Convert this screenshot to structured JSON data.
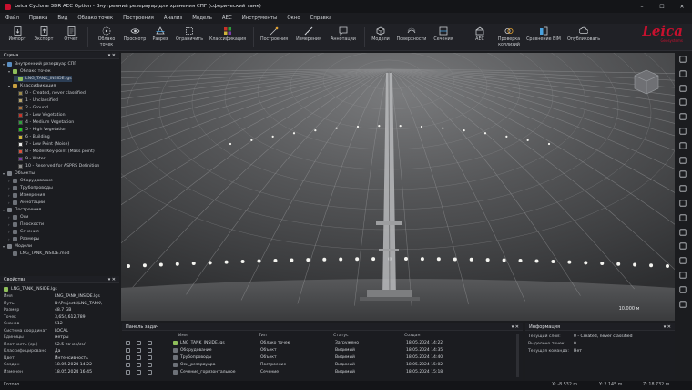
{
  "window": {
    "title": "Leica Cyclone 3DR AEC Option - Внутренний резервуар для хранения СПГ (сферический танк)",
    "minimize": "–",
    "maximize": "☐",
    "close": "✕"
  },
  "menu": [
    "Файл",
    "Правка",
    "Вид",
    "Облако точек",
    "Построения",
    "Анализ",
    "Модель",
    "AEC",
    "Инструменты",
    "Окно",
    "Справка"
  ],
  "ribbon": [
    {
      "label": "Импорт",
      "icon": "import-icon"
    },
    {
      "label": "Экспорт",
      "icon": "export-icon"
    },
    {
      "label": "Отчет",
      "icon": "report-icon"
    },
    {
      "label": "Облако\nточек",
      "icon": "point-cloud-icon"
    },
    {
      "label": "Просмотр",
      "icon": "view-icon"
    },
    {
      "label": "Разрез",
      "icon": "section-icon"
    },
    {
      "label": "Ограничить",
      "icon": "clip-icon"
    },
    {
      "label": "Классификация",
      "icon": "classification-icon"
    },
    {
      "label": "Построения",
      "icon": "constructions-icon"
    },
    {
      "label": "Измерения",
      "icon": "measure-icon"
    },
    {
      "label": "Аннотации",
      "icon": "annotation-icon"
    },
    {
      "label": "Модели",
      "icon": "models-icon"
    },
    {
      "label": "Поверхности",
      "icon": "surfaces-icon"
    },
    {
      "label": "Сечения",
      "icon": "cross-section-icon"
    },
    {
      "label": "AEC",
      "icon": "aec-icon"
    },
    {
      "label": "Проверка\nколлизий",
      "icon": "clash-icon"
    },
    {
      "label": "Сравнение BIM",
      "icon": "bim-compare-icon"
    },
    {
      "label": "Опубликовать",
      "icon": "publish-icon"
    }
  ],
  "logo": {
    "word": "Leica",
    "sub": "Geosystems",
    "color": "#c8102e"
  },
  "scene": {
    "header": "Сцена",
    "root": "Внутренний резервуар СПГ",
    "cloud_group": "Облако точек",
    "cloud_item": "LNG_TANK_INSIDE.lgs",
    "class_group": "Классификация",
    "classes": [
      {
        "label": "0 - Created, never classified",
        "color": "#9c8a4a"
      },
      {
        "label": "1 - Unclassified",
        "color": "#b5a36a"
      },
      {
        "label": "2 - Ground",
        "color": "#a8703a"
      },
      {
        "label": "3 - Low Vegetation",
        "color": "#c83228"
      },
      {
        "label": "4 - Medium Vegetation",
        "color": "#2e9e3e"
      },
      {
        "label": "5 - High Vegetation",
        "color": "#1ec81e"
      },
      {
        "label": "6 - Building",
        "color": "#d0b43a"
      },
      {
        "label": "7 - Low Point (Noise)",
        "color": "#e8e8e8"
      },
      {
        "label": "8 - Model Key-point (Mass point)",
        "color": "#d8503c"
      },
      {
        "label": "9 - Water",
        "color": "#7a3aa8"
      },
      {
        "label": "10 - Reserved for ASPRS Definition",
        "color": "#8f8f8f"
      }
    ],
    "objects_group": "Объекты",
    "objects": [
      "Оборудование",
      "Трубопроводы",
      "Измерения",
      "Аннотации"
    ],
    "constr_group": "Построения",
    "constr": [
      "Оси",
      "Плоскости",
      "Сечения",
      "Размеры"
    ],
    "models_group": "Модели",
    "models": [
      "LNG_TANK_INSIDE.mod"
    ]
  },
  "properties": {
    "header": "Свойства",
    "file": "LNG_TANK_INSIDE.lgs",
    "rows": [
      {
        "k": "Имя",
        "v": "LNG_TANK_INSIDE.lgs"
      },
      {
        "k": "Путь",
        "v": "D:\\Projects\\LNG_TANK\\"
      },
      {
        "k": "Размер",
        "v": "48.7 GB"
      },
      {
        "k": "Точек",
        "v": "3,654,612,789"
      },
      {
        "k": "Сканов",
        "v": "512"
      },
      {
        "k": "Система координат",
        "v": "LOCAL"
      },
      {
        "k": "Единицы",
        "v": "метры"
      },
      {
        "k": "Плотность (ср.)",
        "v": "52.5 точек/см²"
      },
      {
        "k": "Классифицировано",
        "v": "Да"
      },
      {
        "k": "Цвет",
        "v": "Интенсивность"
      },
      {
        "k": "Создан",
        "v": "18.05.2024 14:22"
      },
      {
        "k": "Изменен",
        "v": "18.05.2024 16:45"
      }
    ]
  },
  "viewport": {
    "scale": "10.000 м"
  },
  "tasks": {
    "header": "Панель задач",
    "columns": [
      "Имя",
      "Тип",
      "Статус",
      "Создан"
    ],
    "rows": [
      {
        "name": "LNG_TANK_INSIDE.lgs",
        "type": "Облако точек",
        "status": "Загружено",
        "created": "18.05.2024 14:22"
      },
      {
        "name": "Оборудование",
        "type": "Объект",
        "status": "Видимый",
        "created": "18.05.2024 14:35"
      },
      {
        "name": "Трубопроводы",
        "type": "Объект",
        "status": "Видимый",
        "created": "18.05.2024 14:40"
      },
      {
        "name": "Оси_резервуара",
        "type": "Построение",
        "status": "Видимый",
        "created": "18.05.2024 15:02"
      },
      {
        "name": "Сечение_горизонтальное",
        "type": "Сечение",
        "status": "Видимый",
        "created": "18.05.2024 15:18"
      }
    ]
  },
  "info": {
    "header": "Информация",
    "rows": [
      {
        "k": "Текущий слой:",
        "v": "0 - Created, never classified"
      },
      {
        "k": "Выделено точек:",
        "v": "0"
      },
      {
        "k": "Текущая команда:",
        "v": "Нет"
      }
    ]
  },
  "status": {
    "ready": "Готово",
    "x": "X: -8.532 m",
    "y": "Y: 2.145 m",
    "z": "Z: 18.732 m"
  }
}
